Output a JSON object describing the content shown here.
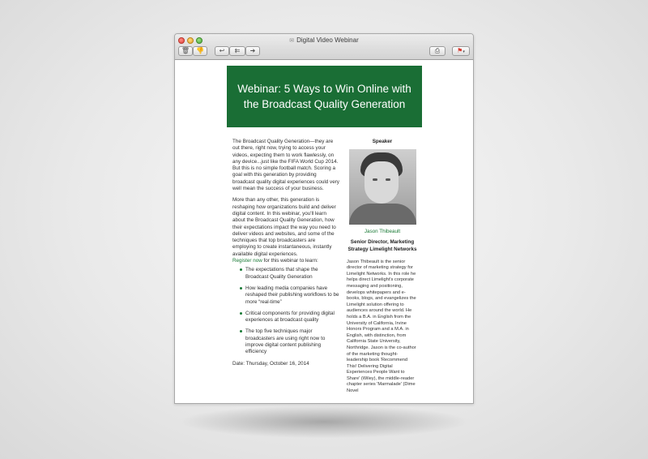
{
  "window": {
    "title": "Digital Video Webinar",
    "icons": [
      "mail-icon"
    ],
    "toolbar": [
      "trash-icon",
      "junk-icon",
      "reply-icon",
      "reply-all-icon",
      "forward-icon",
      "print-icon",
      "flag-icon"
    ]
  },
  "banner": {
    "title": "Webinar: 5 Ways to Win Online with the Broadcast Quality Generation",
    "color": "#1a6e35"
  },
  "body": {
    "para1": "The Broadcast Quality Generation—they are out there, right now, trying to access your videos, expecting them to work flawlessly, on any device...just like the FIFA World Cup 2014. But this is no simple football match. Scoring a goal with this generation by providing broadcast quality digital experiences could very well mean the success of your business.",
    "para2": "More than any other, this generation is reshaping how organizations build and deliver digital content. In this webinar, you'll learn about the Broadcast Quality Generation, how their expectations impact the way you need to deliver videos and websites, and some of the techniques that top broadcasters are employing to create instantaneous, instantly available digital experiences.",
    "register_link": "Register now",
    "register_rest": " for this webinar to learn:",
    "bullets": [
      "The expectations that shape the Broadcast Quality Generation",
      "How leading media companies have reshaped their publishing workflows to be more “real-time”",
      "Critical components for providing digital experiences at broadcast quality",
      "The top five techniques major broadcasters are using right now to improve digital content publishing efficiency"
    ],
    "date": "Date: Thursday, October 16, 2014"
  },
  "speaker": {
    "heading": "Speaker",
    "name": "Jason Thibeault",
    "title": "Senior Director, Marketing Strategy Limelight Networks",
    "bio": "Jason Thibeault is the senior director of marketing strategy for Limelight Networks. In this role he helps direct Limelight's corporate messaging and positioning, develops whitepapers and e-books, blogs, and evangelizes the Limelight solution offering to audiences around the world. He holds a B.A. in English from the University of California, Irvine Honors Program and a M.A. in English, with distinction, from California State University, Northridge. Jason is the co-author of the marketing thought-leadership book 'Recommend This! Delivering Digital Experiences People Want to Share' (Wiley), the middle-reader chapter series 'Marmalade' (Dime Novel"
  }
}
